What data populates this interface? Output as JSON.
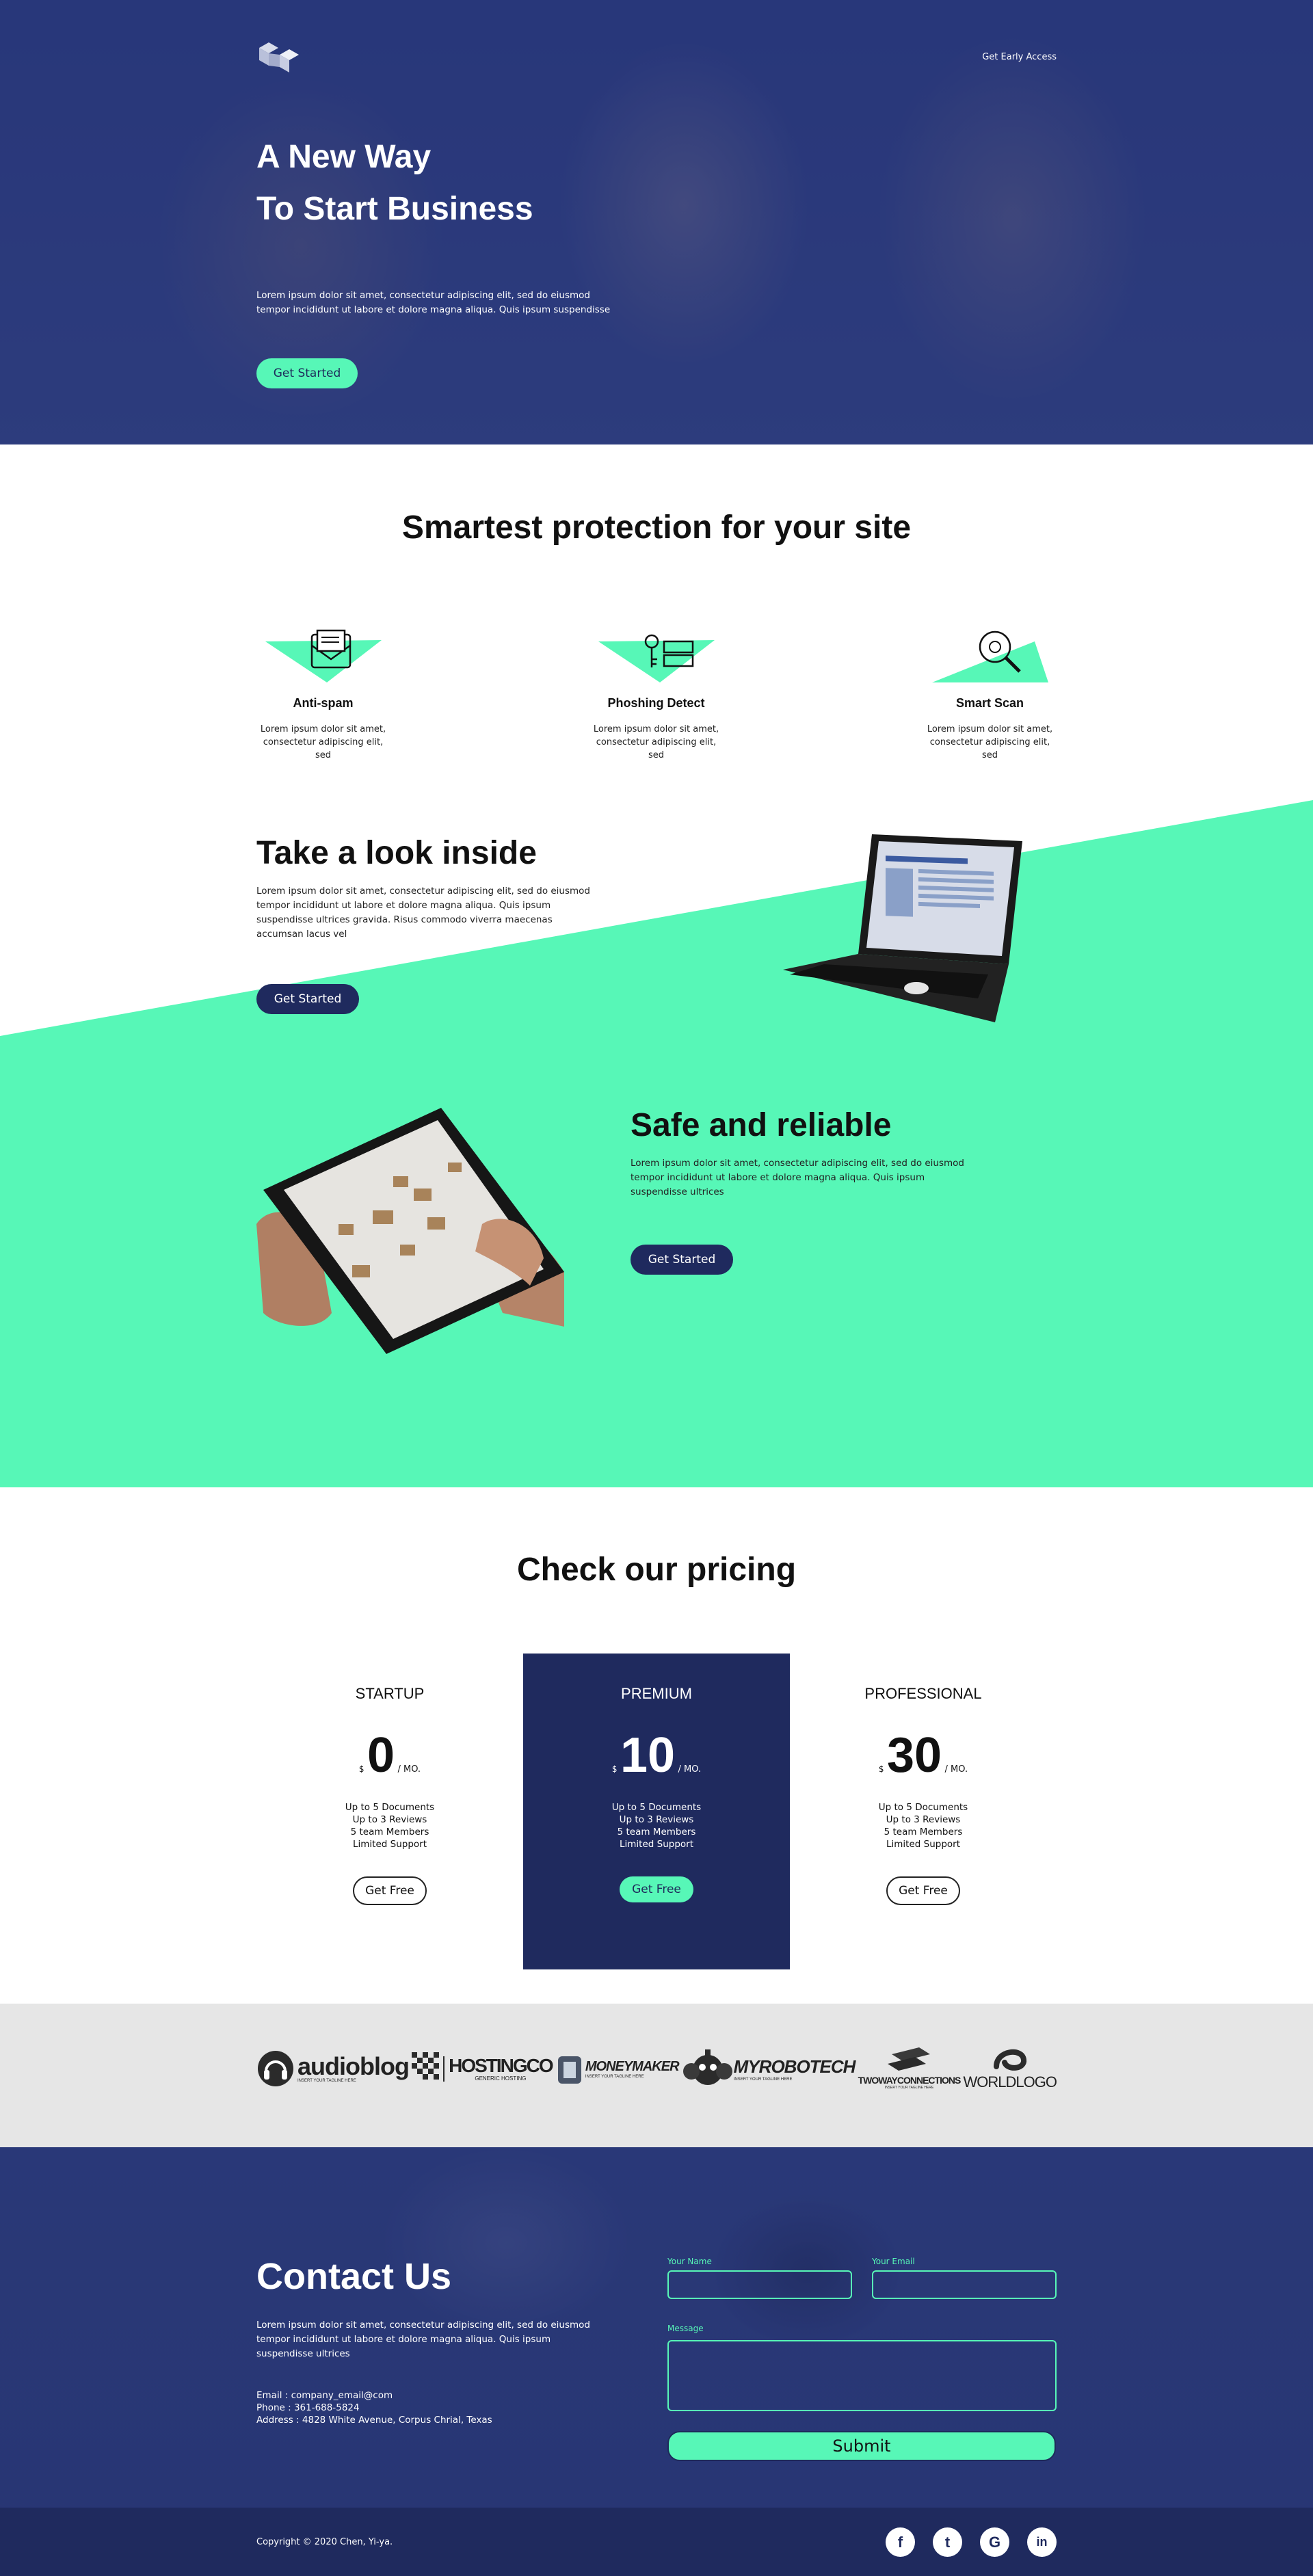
{
  "hero": {
    "cta_link": "Get Early Access",
    "title_line1": "A New Way",
    "title_line2": "To Start Business",
    "text": "Lorem ipsum dolor sit amet, consectetur adipiscing elit, sed do eiusmod tempor incididunt ut labore et dolore magna aliqua. Quis ipsum suspendisse",
    "button": "Get Started"
  },
  "features": {
    "title": "Smartest protection for your site",
    "items": [
      {
        "title": "Anti-spam",
        "text": "Lorem ipsum dolor sit amet, consectetur adipiscing elit, sed",
        "icon": "envelope-icon"
      },
      {
        "title": "Phoshing Detect",
        "text": "Lorem ipsum dolor sit amet, consectetur adipiscing elit, sed",
        "icon": "key-card-icon"
      },
      {
        "title": "Smart Scan",
        "text": "Lorem ipsum dolor sit amet, consectetur adipiscing elit, sed",
        "icon": "magnifier-icon"
      }
    ]
  },
  "inside": {
    "title": "Take a look inside",
    "text": "Lorem ipsum dolor sit amet, consectetur adipiscing elit, sed do eiusmod tempor incididunt ut labore et dolore magna aliqua. Quis ipsum suspendisse ultrices gravida. Risus commodo viverra maecenas accumsan lacus vel",
    "button": "Get Started"
  },
  "safe": {
    "title": "Safe and reliable",
    "text": "Lorem ipsum dolor sit amet, consectetur adipiscing elit, sed do eiusmod tempor incididunt ut labore et dolore magna aliqua. Quis ipsum suspendisse ultrices",
    "button": "Get Started"
  },
  "pricing": {
    "title": "Check our pricing",
    "plans": [
      {
        "name": "STARTUP",
        "currency": "$",
        "price": "0",
        "period": "/ MO.",
        "features": [
          "Up to 5 Documents",
          "Up to 3 Reviews",
          "5 team Members",
          "Limited Support"
        ],
        "button": "Get Free"
      },
      {
        "name": "PREMIUM",
        "currency": "$",
        "price": "10",
        "period": "/ MO.",
        "features": [
          "Up to 5 Documents",
          "Up to 3 Reviews",
          "5 team Members",
          "Limited Support"
        ],
        "button": "Get Free"
      },
      {
        "name": "PROFESSIONAL",
        "currency": "$",
        "price": "30",
        "period": "/ MO.",
        "features": [
          "Up to 5 Documents",
          "Up to 3 Reviews",
          "5 team Members",
          "Limited Support"
        ],
        "button": "Get Free"
      }
    ]
  },
  "logos": [
    {
      "main": "audioblog",
      "sub": "INSERT YOUR TAGLINE HERE"
    },
    {
      "main": "HOSTINGCO",
      "sub": "GENERIC HOSTING"
    },
    {
      "main": "MONEYMAKER",
      "sub": "INSERT YOUR TAGLINE HERE"
    },
    {
      "main": "MYROBOTECH",
      "sub": "INSERT YOUR TAGLINE HERE"
    },
    {
      "main": "TWOWAYCONNECTIONS",
      "sub": "INSERT YOUR TAGLINE HERE"
    },
    {
      "main": "WORLDLOGO",
      "sub": ""
    }
  ],
  "contact": {
    "title": "Contact Us",
    "text": "Lorem ipsum dolor sit amet, consectetur adipiscing elit, sed do eiusmod tempor incididunt ut labore et dolore magna aliqua. Quis ipsum suspendisse ultrices",
    "email": "Email : company_email@com",
    "phone": "Phone : 361-688-5824",
    "address": "Address : 4828 White Avenue, Corpus Chrial, Texas",
    "name_label": "Your Name",
    "email_label": "Your Email",
    "message_label": "Message",
    "submit": "Submit"
  },
  "footer": {
    "copyright": "Copyright © 2020 Chen, Yi-ya.",
    "socials": [
      {
        "glyph": "f",
        "icon": "facebook-icon"
      },
      {
        "glyph": "t",
        "icon": "twitter-icon"
      },
      {
        "glyph": "G",
        "icon": "google-icon"
      },
      {
        "glyph": "in",
        "icon": "linkedin-icon"
      }
    ]
  },
  "colors": {
    "navy": "#1f2a5e",
    "mint": "#57f7b7",
    "hero_overlay": "#2f3e7c",
    "logo_band": "#e6e6e6"
  }
}
